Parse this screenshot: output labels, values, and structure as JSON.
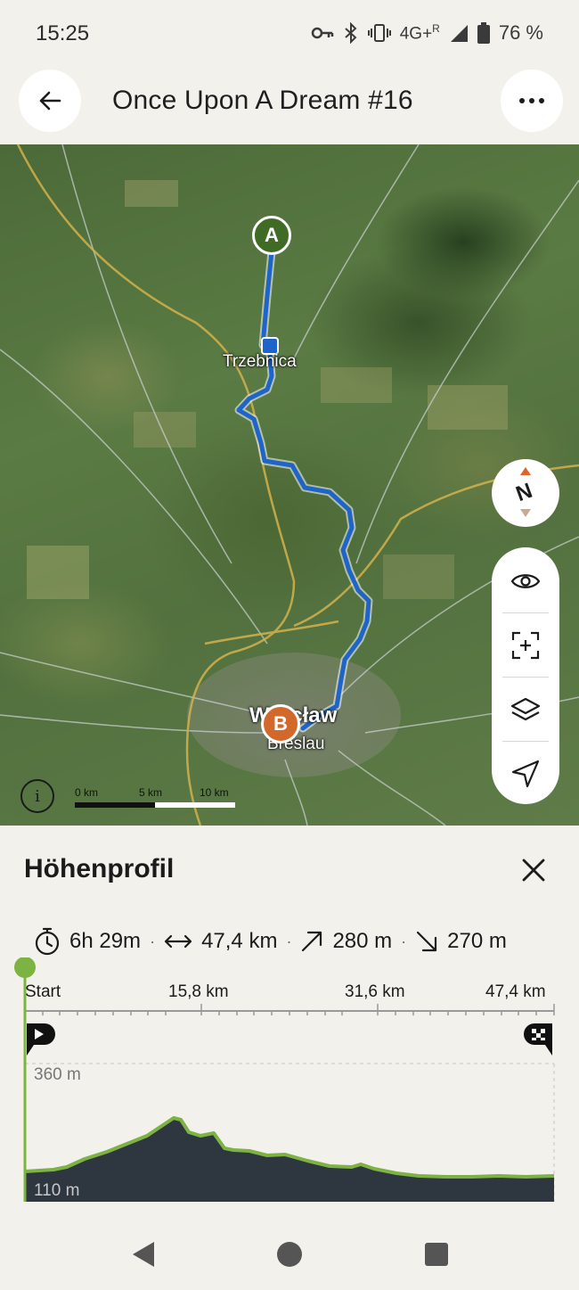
{
  "status_bar": {
    "time": "15:25",
    "network": "4G+",
    "roaming": "R",
    "battery": "76 %"
  },
  "header": {
    "title": "Once Upon A Dream #16",
    "back_icon": "arrow-left-icon",
    "more_icon": "more-horizontal-icon"
  },
  "map": {
    "places": {
      "trzebnica": "Trzebnica",
      "wroclaw": "Wrocław",
      "breslau": "Breslau"
    },
    "markers": {
      "start": "A",
      "end": "B"
    },
    "route_color": "#1f64c8",
    "compass_label": "N",
    "controls": [
      "eye-icon",
      "recenter-icon",
      "layers-icon",
      "navigate-icon"
    ],
    "scale": {
      "labels": [
        "0 km",
        "5 km",
        "10 km"
      ]
    },
    "info_label": "i"
  },
  "profile_sheet": {
    "title": "Höhenprofil",
    "stats": {
      "duration": "6h 29m",
      "distance": "47,4 km",
      "ascent": "280 m",
      "descent": "270 m"
    },
    "distance_axis": [
      "Start",
      "15,8 km",
      "31,6 km",
      "47,4 km"
    ],
    "altitude_axis": {
      "max": "360 m",
      "min": "110 m"
    },
    "profile_color": "#7cb342",
    "fill_color": "#2e3640"
  },
  "nav_bar": {
    "back": "nav-back-icon",
    "home": "nav-home-icon",
    "recents": "nav-recents-icon"
  }
}
